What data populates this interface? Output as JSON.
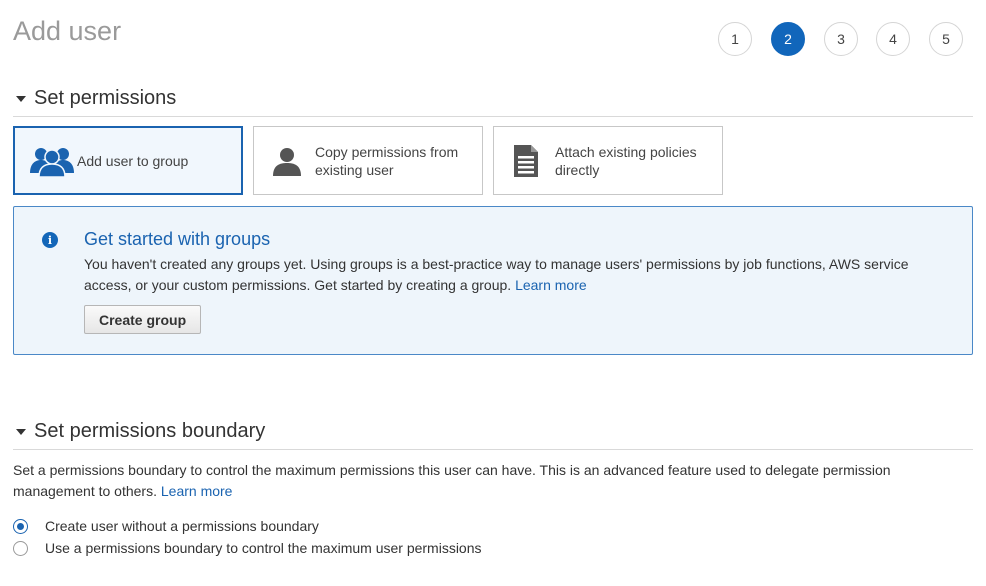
{
  "page": {
    "title": "Add user"
  },
  "steps": [
    {
      "label": "1",
      "active": false
    },
    {
      "label": "2",
      "active": true
    },
    {
      "label": "3",
      "active": false
    },
    {
      "label": "4",
      "active": false
    },
    {
      "label": "5",
      "active": false
    }
  ],
  "set_permissions": {
    "title": "Set permissions",
    "options": [
      {
        "label": "Add user to group",
        "icon": "users-group-icon",
        "selected": true
      },
      {
        "label": "Copy permissions from existing user",
        "icon": "user-silhouette-icon",
        "selected": false
      },
      {
        "label": "Attach existing policies directly",
        "icon": "document-icon",
        "selected": false
      }
    ]
  },
  "info_box": {
    "icon": "info-icon",
    "icon_glyph": "i",
    "title": "Get started with groups",
    "text": "You haven't created any groups yet. Using groups is a best-practice way to manage users' permissions by job functions, AWS service access, or your custom permissions. Get started by creating a group.",
    "link": "Learn more",
    "button": "Create group"
  },
  "boundary": {
    "title": "Set permissions boundary",
    "description": "Set a permissions boundary to control the maximum permissions this user can have. This is an advanced feature used to delegate permission management to others.",
    "link": "Learn more",
    "radios": [
      {
        "label": "Create user without a permissions boundary",
        "checked": true
      },
      {
        "label": "Use a permissions boundary to control the maximum user permissions",
        "checked": false
      }
    ]
  },
  "colors": {
    "accent": "#1a63b0",
    "active_step": "#1166bb",
    "info_bg": "#eef5fb",
    "info_border": "#4a88c7",
    "icon_gray": "#555555"
  }
}
